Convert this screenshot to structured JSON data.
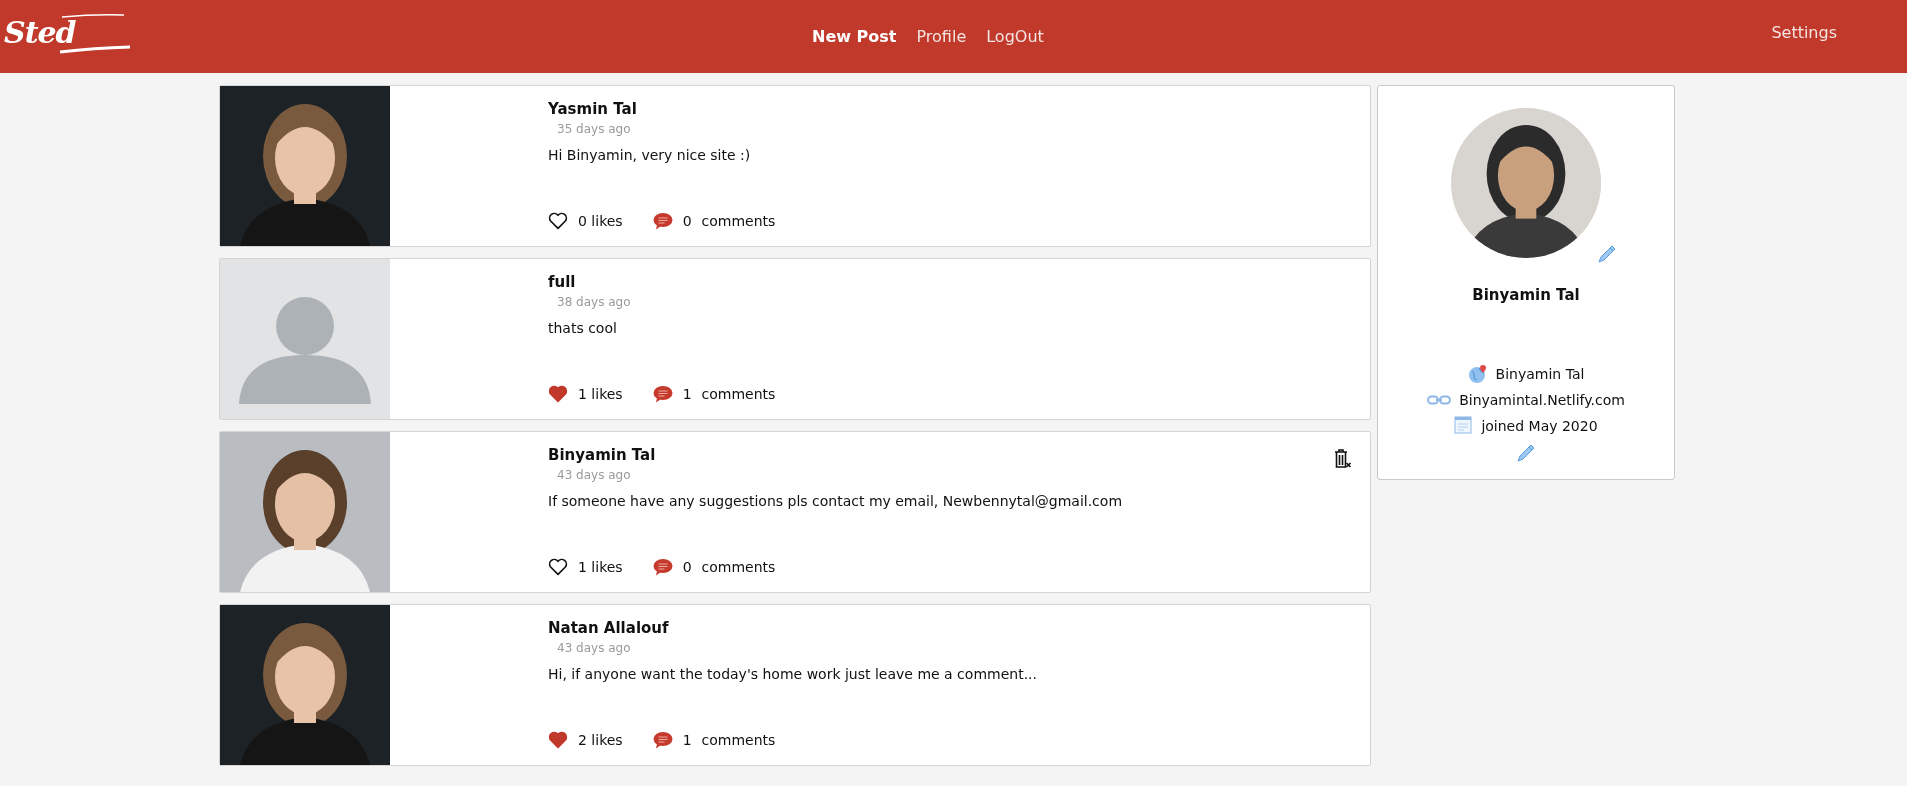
{
  "header": {
    "logo": "Sted",
    "nav": [
      {
        "label": "New Post",
        "selected": true
      },
      {
        "label": "Profile",
        "selected": false
      },
      {
        "label": "LogOut",
        "selected": false
      }
    ],
    "settings": "Settings"
  },
  "posts": [
    {
      "author": "Yasmin Tal",
      "time": "35 days ago",
      "text": "Hi Binyamin, very nice site :)",
      "liked": false,
      "likes": "0 likes",
      "comment_count": "0",
      "comments_label": "comments",
      "deletable": false
    },
    {
      "author": "full",
      "time": "38 days ago",
      "text": "thats cool",
      "avatar": {
        "kind": "placeholder"
      },
      "liked": true,
      "likes": "1 likes",
      "comment_count": "1",
      "comments_label": "comments",
      "deletable": false
    },
    {
      "author": "Binyamin Tal",
      "time": "43 days ago",
      "text": "If someone have any suggestions pls contact my email, Newbennytal@gmail.com",
      "liked": false,
      "likes": "1 likes",
      "comment_count": "0",
      "comments_label": "comments",
      "deletable": true
    },
    {
      "author": "Natan Allalouf",
      "time": "43 days ago",
      "text": "Hi, if anyone want the today's home work just leave me a comment...",
      "liked": true,
      "likes": "2 likes",
      "comment_count": "1",
      "comments_label": "comments",
      "deletable": false
    }
  ],
  "profile": {
    "name": "Binyamin Tal",
    "location": "Binyamin Tal",
    "website": "Binyamintal.Netlify.com",
    "joined": "joined May 2020"
  }
}
